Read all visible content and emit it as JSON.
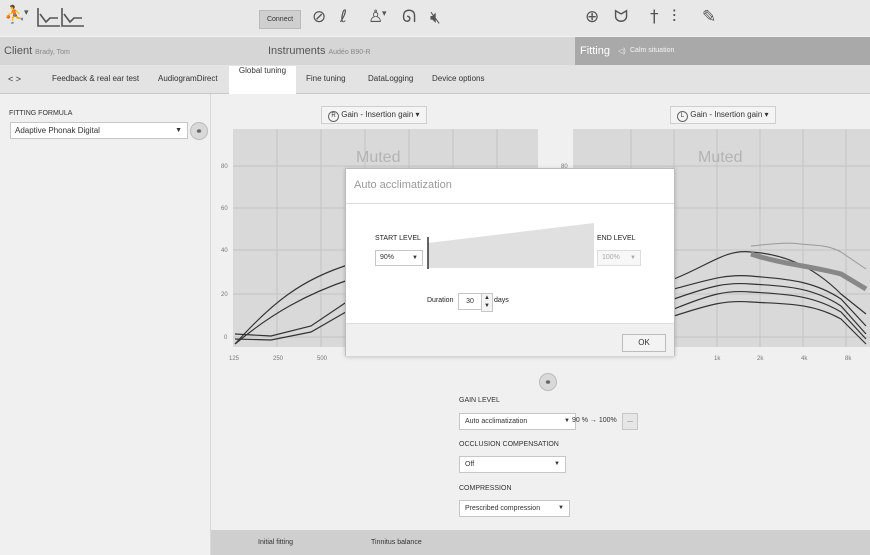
{
  "toolbar": {
    "connect_label": "Connect",
    "icons": [
      "client-icon",
      "audiogram-icon",
      "connect-icon",
      "hearing-instrument-icon",
      "battery-icon",
      "ear-icon",
      "mute-icon",
      "target-icon",
      "binaural-icon",
      "remote-icon",
      "sliders-icon",
      "tools-icon"
    ]
  },
  "sections": {
    "client_label": "Client",
    "client_name": "Brady, Tom",
    "instruments_label": "Instruments",
    "instruments_model": "Audéo B90-R",
    "fitting_label": "Fitting",
    "fitting_situation": "Calm situation"
  },
  "tabs": [
    "Feedback & real ear test",
    "AudiogramDirect",
    "Global tuning",
    "Fine tuning",
    "DataLogging",
    "Device options"
  ],
  "nav_arrows": "< >",
  "left_panel": {
    "formula_heading": "FITTING FORMULA",
    "formula_value": "Adaptive Phonak Digital"
  },
  "charts": {
    "right_ear_label": "Gain - Insertion gain",
    "left_ear_label": "Gain - Insertion gain",
    "right_badge": "R",
    "left_badge": "L",
    "muted_text": "Muted",
    "y_ticks": [
      "80",
      "60",
      "40",
      "20",
      "0"
    ],
    "x_ticks": [
      "125",
      "250",
      "500",
      "1k",
      "2k",
      "4k",
      "8k"
    ]
  },
  "modal": {
    "title": "Auto acclimatization",
    "start_level_label": "START LEVEL",
    "start_level_value": "90%",
    "end_level_label": "END LEVEL",
    "end_level_value": "100%",
    "duration_label": "Duration",
    "duration_value": "30",
    "duration_unit": "days",
    "ok_label": "OK"
  },
  "controls": {
    "gain_level_label": "GAIN LEVEL",
    "gain_level_value": "Auto acclimatization",
    "gain_level_range": "90 % → 100%",
    "more_label": "...",
    "occlusion_label": "OCCLUSION COMPENSATION",
    "occlusion_value": "Off",
    "compression_label": "COMPRESSION",
    "compression_value": "Prescribed compression"
  },
  "bottom_tabs": [
    "Initial fitting",
    "Tinnitus balance"
  ],
  "colors": {
    "toolbar_bg": "#e8e8e8",
    "section_bg": "#d6d6d6",
    "fitting_bg": "#a9a9a9",
    "chart_bg": "#d9d9d9",
    "curve": "#333333"
  }
}
